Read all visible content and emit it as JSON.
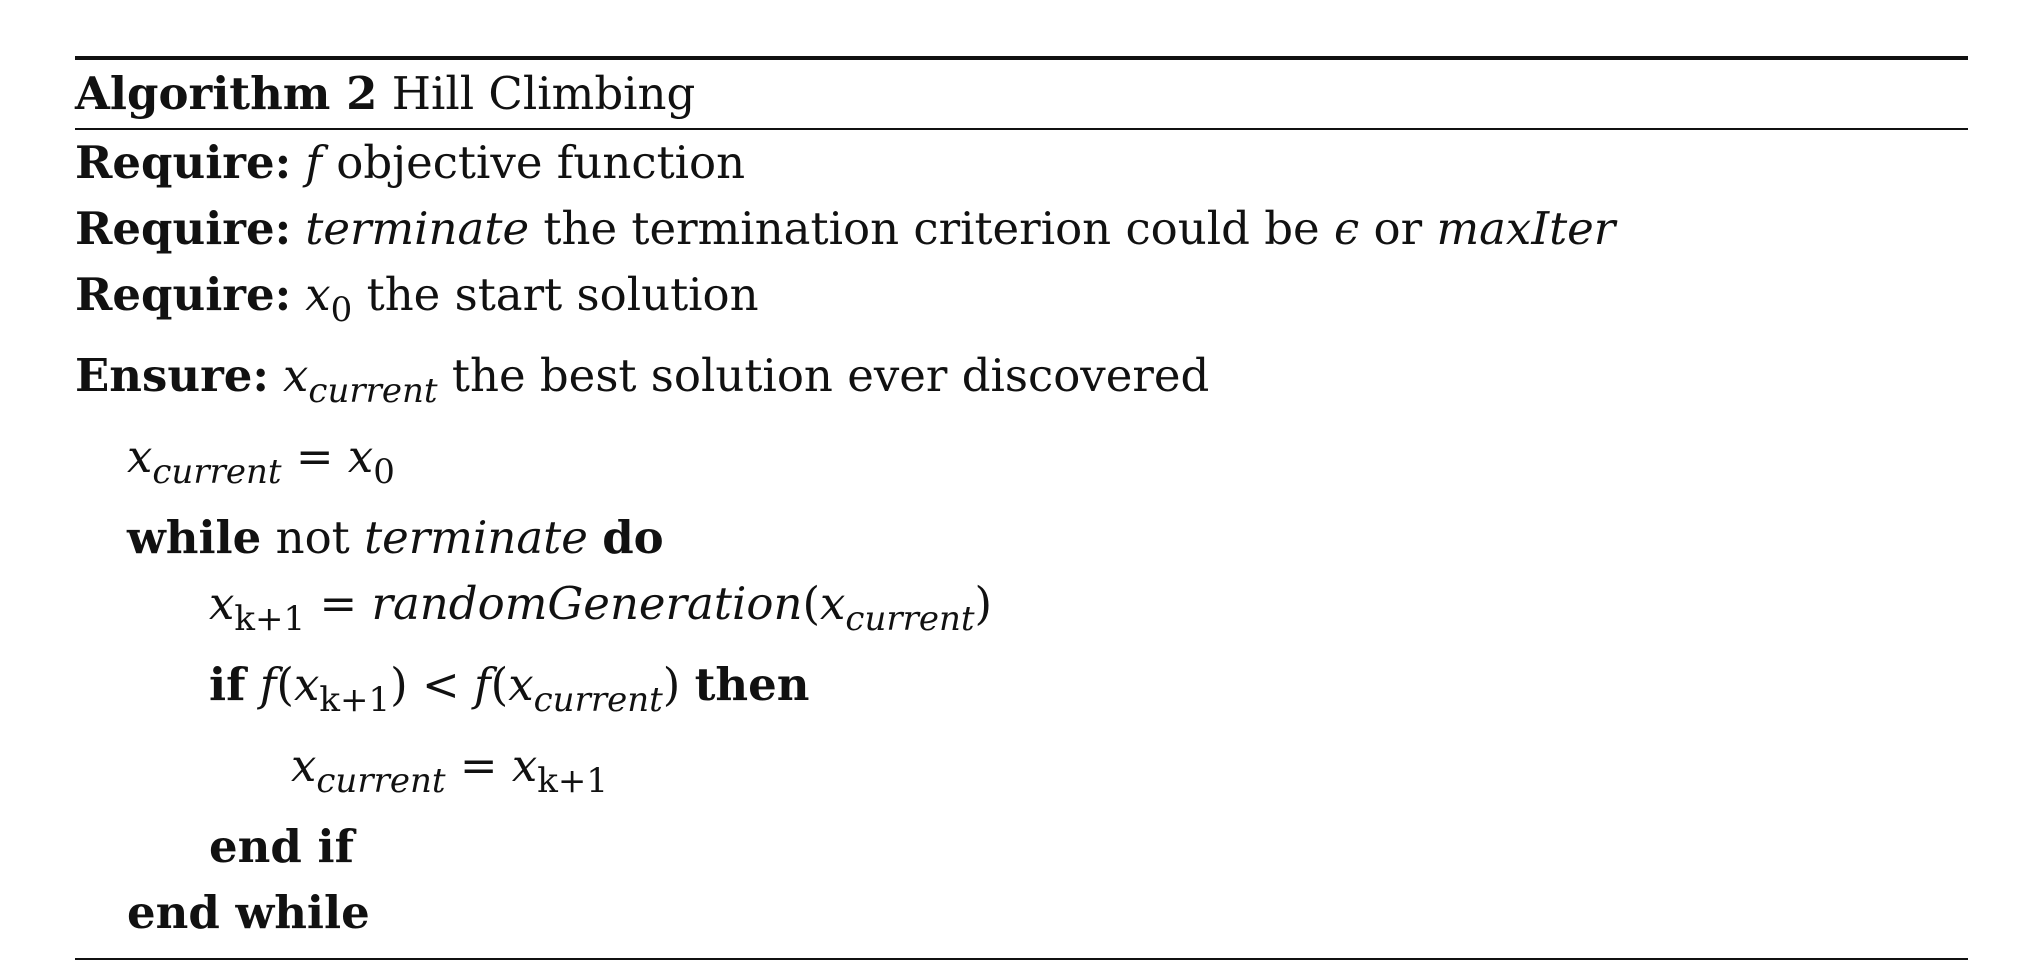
{
  "algorithm": {
    "label": "Algorithm 2",
    "name": "Hill Climbing"
  },
  "require1": {
    "keyword": "Require:",
    "var": "f",
    "desc": "objective function"
  },
  "require2": {
    "keyword": "Require:",
    "var": "terminate",
    "desc": "the termination criterion could be",
    "epsilon": "ϵ",
    "or": "or",
    "maxiter": "maxIter"
  },
  "require3": {
    "keyword": "Require:",
    "var": "x",
    "sub": "0",
    "desc": "the start solution"
  },
  "ensure": {
    "keyword": "Ensure:",
    "var": "x",
    "sub": "current",
    "desc": "the best solution ever discovered"
  },
  "step_init": {
    "lhs_var": "x",
    "lhs_sub": "current",
    "eq": "=",
    "rhs_var": "x",
    "rhs_sub": "0"
  },
  "step_while": {
    "kw_while": "while",
    "not": "not",
    "cond": "terminate",
    "kw_do": "do"
  },
  "step_gen": {
    "lhs_var": "x",
    "lhs_sub": "k+1",
    "eq": "=",
    "func": "randomGeneration",
    "open": "(",
    "arg_var": "x",
    "arg_sub": "current",
    "close": ")"
  },
  "step_if": {
    "kw_if": "if",
    "f1": "f",
    "open1": "(",
    "x1": "x",
    "x1_sub": "k+1",
    "close1": ")",
    "lt": "<",
    "f2": "f",
    "open2": "(",
    "x2": "x",
    "x2_sub": "current",
    "close2": ")",
    "kw_then": "then"
  },
  "step_assign": {
    "lhs_var": "x",
    "lhs_sub": "current",
    "eq": "=",
    "rhs_var": "x",
    "rhs_sub": "k+1"
  },
  "step_endif": {
    "kw": "end if"
  },
  "step_endwhile": {
    "kw": "end while"
  }
}
